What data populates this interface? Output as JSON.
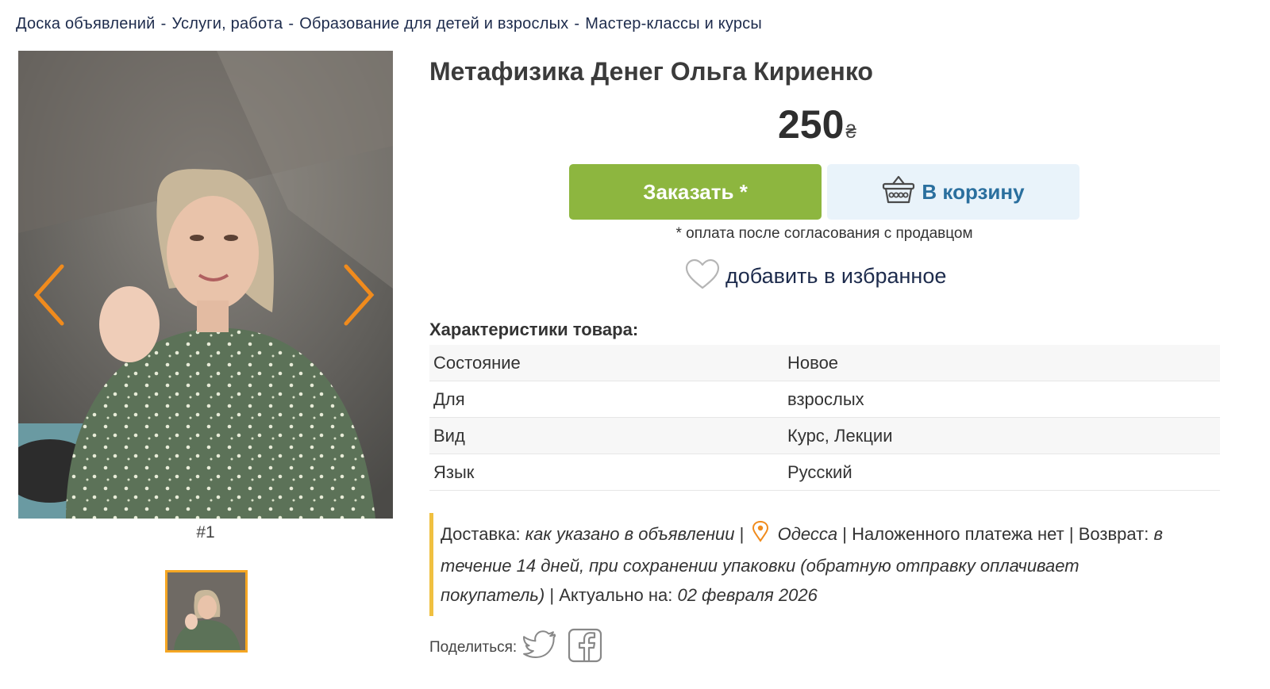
{
  "breadcrumb": {
    "items": [
      "Доска объявлений",
      "Услуги, работа",
      "Образование для детей и взрослых",
      "Мастер-классы и курсы"
    ],
    "separator": "-"
  },
  "gallery": {
    "counter": "#1",
    "icons": {
      "prev": "chevron-left-icon",
      "next": "chevron-right-icon"
    }
  },
  "product": {
    "title": "Метафизика Денег Ольга Кириенко",
    "price": "250",
    "currency": "₴"
  },
  "actions": {
    "order_label": "Заказать *",
    "cart_label": "В корзину",
    "payment_note": "* оплата после согласования с продавцом",
    "favorite_label": "добавить в избранное"
  },
  "specs": {
    "title": "Характеристики товара:",
    "rows": [
      {
        "key": "Состояние",
        "value": "Новое"
      },
      {
        "key": "Для",
        "value": "взрослых"
      },
      {
        "key": "Вид",
        "value": "Курс, Лекции"
      },
      {
        "key": "Язык",
        "value": "Русский"
      }
    ]
  },
  "delivery": {
    "delivery_label": "Доставка:",
    "delivery_value": "как указано в объявлении",
    "city": "Одесса",
    "cod": "Наложенного платежа нет",
    "return_label": "Возврат:",
    "return_value": "в течение 14 дней, при сохранении упаковки (обратную отправку оплачивает покупатель)",
    "actual_label": "Актуально на:",
    "actual_value": "02 февраля 2026",
    "sep": "|"
  },
  "share": {
    "label": "Поделиться:"
  },
  "colors": {
    "order": "#8db63f",
    "cart_bg": "#e9f3fa",
    "cart_text": "#2a6f9e",
    "accent_orange": "#f5a623",
    "delivery_border": "#f0c040",
    "link_dark": "#1d2b4c"
  }
}
